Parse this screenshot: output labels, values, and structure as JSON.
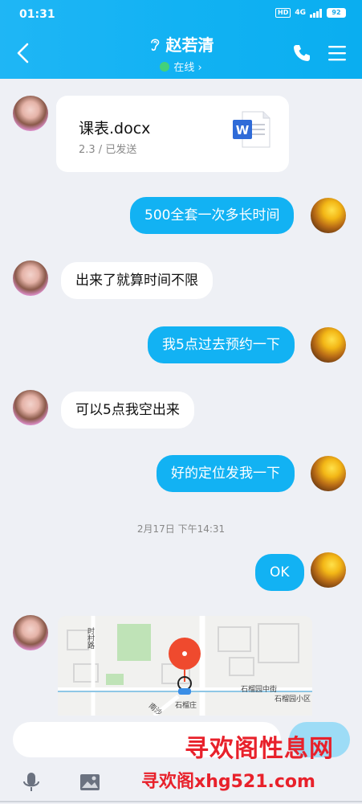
{
  "status_bar": {
    "time": "01:31",
    "hd": "HD",
    "network": "4G",
    "battery": "92"
  },
  "header": {
    "contact_name": "赵若清",
    "status": "在线 ›"
  },
  "file_message": {
    "file_name": "课表.docx",
    "meta": "2.3 / 已发送"
  },
  "messages": [
    {
      "side": "out",
      "text": "500全套一次多长时间"
    },
    {
      "side": "in",
      "text": "出来了就算时间不限"
    },
    {
      "side": "out",
      "text": "我5点过去预约一下"
    },
    {
      "side": "in",
      "text": "可以5点我空出来"
    },
    {
      "side": "out",
      "text": "好的定位发我一下"
    },
    {
      "side": "out",
      "text": "OK"
    }
  ],
  "timestamp": "2月17日 下午14:31",
  "map": {
    "labels": {
      "road_1": "时村路",
      "street": "石榴园中街",
      "community": "石榴园小区",
      "poi": "石榴庄",
      "road_2": "南沙..."
    }
  },
  "watermark": {
    "line1": "寻欢阁性息网",
    "line2": "寻欢阁xhg521.com"
  },
  "colors": {
    "accent": "#12b2f3",
    "online": "#43d17a",
    "pin": "#ef4a2e",
    "watermark": "#e8212b"
  },
  "icons": {
    "back": "chevron-left-icon",
    "ear": "ear-icon",
    "phone": "phone-icon",
    "menu": "menu-icon",
    "word": "word-doc-icon",
    "mic": "microphone-icon",
    "image": "image-icon",
    "pin": "location-pin-icon"
  }
}
